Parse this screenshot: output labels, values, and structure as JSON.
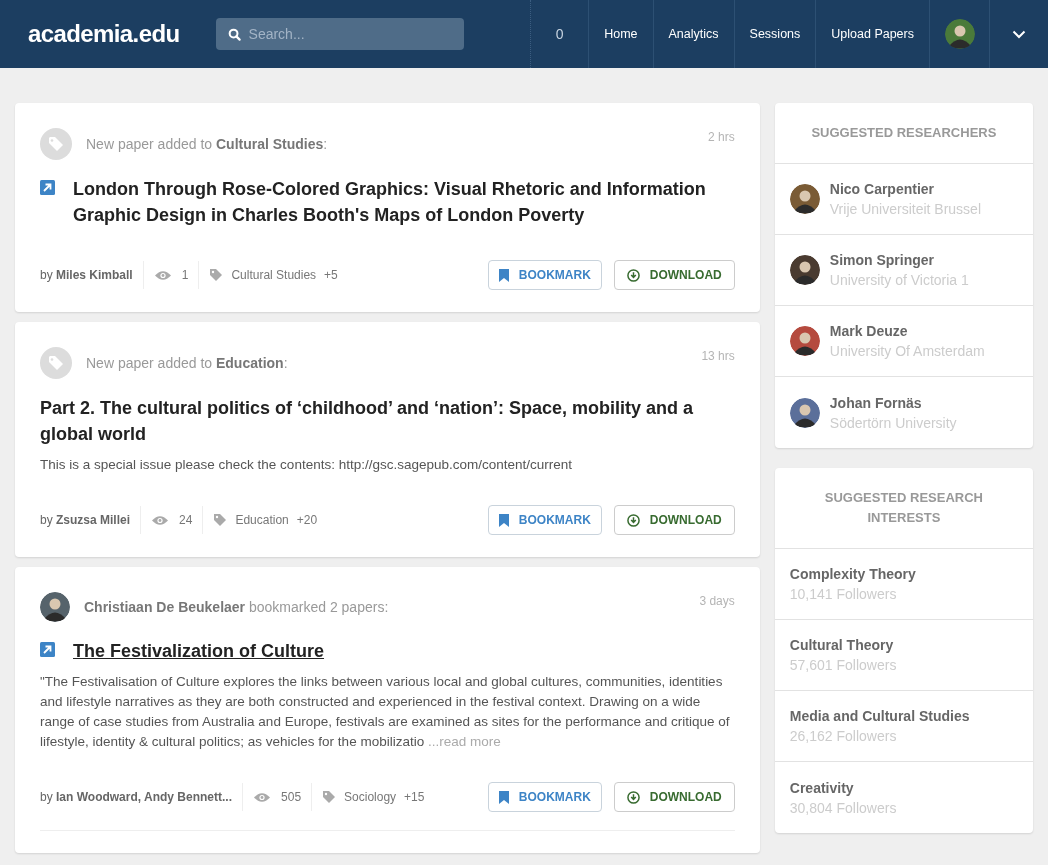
{
  "header": {
    "logo": "academia.edu",
    "search": {
      "placeholder": "Search..."
    },
    "nav": [
      {
        "label": "0",
        "kind": "count"
      },
      {
        "label": "Home",
        "kind": "link"
      },
      {
        "label": "Analytics",
        "kind": "link"
      },
      {
        "label": "Sessions",
        "kind": "link"
      },
      {
        "label": "Upload Papers",
        "kind": "link"
      },
      {
        "kind": "avatar"
      },
      {
        "kind": "menu"
      }
    ]
  },
  "feed": [
    {
      "kind": "tag",
      "headline": "New paper added to **Cultural Studies**:",
      "time": "2 hrs",
      "title": "London Through Rose-Colored Graphics: Visual Rhetoric and Information Graphic Design in Charles Booth's Maps of London Poverty",
      "external": true,
      "hovered": false,
      "authors": "by **Miles Kimball**",
      "views": "1",
      "topic": "Cultural Studies",
      "topic_more": "+5",
      "buttons": [
        "BOOKMARK",
        "DOWNLOAD"
      ]
    },
    {
      "kind": "tag",
      "headline": "New paper added to **Education**:",
      "time": "13 hrs",
      "title": "Part 2. The cultural politics of ‘childhood’ and ‘nation’: Space, mobility and a global world",
      "external": false,
      "hovered": false,
      "description": "This is a special issue please check the contents: http://gsc.sagepub.com/content/current",
      "authors": "by **Zsuzsa Millei**",
      "views": "24",
      "topic": "Education",
      "topic_more": "+20",
      "buttons": [
        "BOOKMARK",
        "DOWNLOAD"
      ]
    },
    {
      "kind": "user",
      "headline": "**Christiaan De Beukelaer** bookmarked 2 papers:",
      "time": "3 days",
      "title": "The Festivalization of Culture",
      "external": true,
      "hovered": true,
      "description": "\"The Festivalisation of Culture explores the links between various local and global cultures, communities, identities and lifestyle narratives as they are both constructed and experienced in the festival context. Drawing on a wide range of case studies from Australia and Europe, festivals are examined as sites for the performance and critique of lifestyle, identity & cultural politics; as vehicles for the mobilizatio",
      "read_more": "...read more",
      "authors": "by **Ian Woodward, Andy Bennett...**",
      "views": "505",
      "topic": "Sociology",
      "topic_more": "+15",
      "buttons": [
        "BOOKMARK",
        "DOWNLOAD"
      ]
    }
  ],
  "sidebar": {
    "researchers": {
      "title": "SUGGESTED RESEARCHERS",
      "items": [
        {
          "name": "Nico Carpentier",
          "affiliation": "Vrije Universiteit Brussel"
        },
        {
          "name": "Simon Springer",
          "affiliation": "University of Victoria 1"
        },
        {
          "name": "Mark Deuze",
          "affiliation": "University Of Amsterdam"
        },
        {
          "name": "Johan Fornäs",
          "affiliation": "Södertörn University"
        }
      ]
    },
    "interests": {
      "title": "SUGGESTED RESEARCH INTERESTS",
      "items": [
        {
          "name": "Complexity Theory",
          "followers": "10,141 Followers"
        },
        {
          "name": "Cultural Theory",
          "followers": "57,601 Followers"
        },
        {
          "name": "Media and Cultural Studies",
          "followers": "26,162 Followers"
        },
        {
          "name": "Creativity",
          "followers": "30,804 Followers"
        }
      ]
    }
  }
}
